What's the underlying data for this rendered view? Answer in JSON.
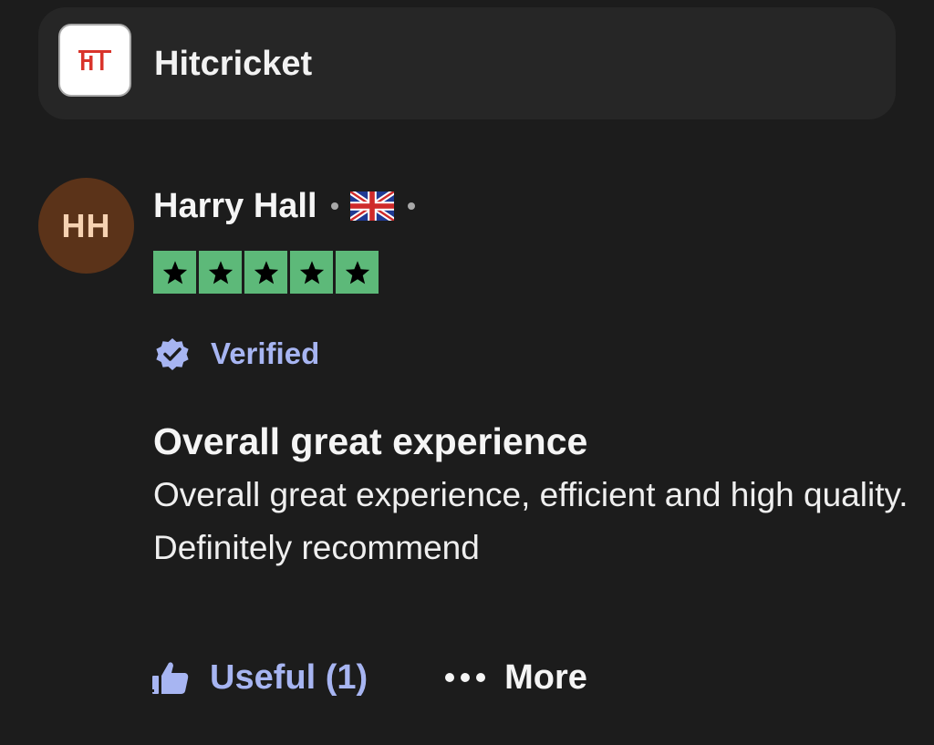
{
  "company": {
    "name": "Hitcricket",
    "logo_icon": "hitcricket-logo-icon",
    "logo_color": "#d9342b"
  },
  "review": {
    "avatar_initials": "HH",
    "avatar_color": "#5b3319",
    "avatar_text_color": "#f6d2b2",
    "reviewer_name": "Harry Hall",
    "country_icon": "uk-flag-icon",
    "rating": 5,
    "rating_max": 5,
    "star_color": "#5db979",
    "verified_label": "Verified",
    "verified_icon": "verified-badge-icon",
    "title": "Overall great experience",
    "body": "Overall great experience, efficient and high quality. Definitely recommend"
  },
  "actions": {
    "useful_label": "Useful (1)",
    "useful_icon": "thumbs-up-icon",
    "more_label": "More",
    "more_icon": "ellipsis-icon"
  },
  "colors": {
    "background": "#1c1c1c",
    "card": "#262626",
    "accent": "#a7b5f2"
  }
}
